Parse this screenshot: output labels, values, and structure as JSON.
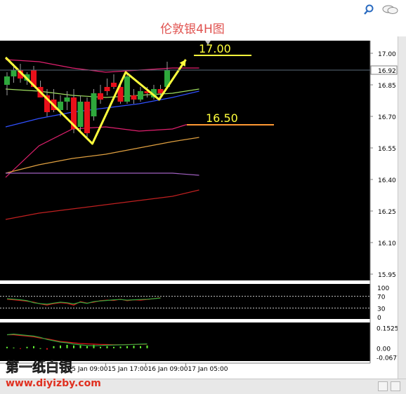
{
  "window": {
    "title": "伦敦银4H图",
    "icons": [
      "search-icon",
      "chat-icon"
    ]
  },
  "colors": {
    "background": "#000000",
    "bull": "#2ea83c",
    "bear": "#e8101a",
    "annotation": "#ffff3c",
    "level_line": "#ff9933"
  },
  "chart_data": {
    "type": "candlestick",
    "y_axis_ticks": [
      "17.00",
      "16.85",
      "16.70",
      "16.55",
      "16.40",
      "16.25",
      "16.10",
      "15.95"
    ],
    "ylim": [
      15.92,
      17.06
    ],
    "current_price": "16.92",
    "x_axis_ticks": [
      "15 Jan 09:00",
      "15 Jan 17:00",
      "16 Jan 09:00",
      "17 Jan 05:00"
    ],
    "candles": [
      {
        "o": 16.85,
        "h": 16.91,
        "l": 16.8,
        "c": 16.89
      },
      {
        "o": 16.89,
        "h": 16.95,
        "l": 16.86,
        "c": 16.92
      },
      {
        "o": 16.92,
        "h": 16.95,
        "l": 16.86,
        "c": 16.88
      },
      {
        "o": 16.87,
        "h": 16.91,
        "l": 16.85,
        "c": 16.9
      },
      {
        "o": 16.92,
        "h": 16.94,
        "l": 16.84,
        "c": 16.84
      },
      {
        "o": 16.84,
        "h": 16.87,
        "l": 16.79,
        "c": 16.79
      },
      {
        "o": 16.8,
        "h": 16.83,
        "l": 16.7,
        "c": 16.72
      },
      {
        "o": 16.78,
        "h": 16.83,
        "l": 16.72,
        "c": 16.73
      },
      {
        "o": 16.73,
        "h": 16.8,
        "l": 16.7,
        "c": 16.77
      },
      {
        "o": 16.77,
        "h": 16.82,
        "l": 16.73,
        "c": 16.79
      },
      {
        "o": 16.79,
        "h": 16.83,
        "l": 16.62,
        "c": 16.64
      },
      {
        "o": 16.65,
        "h": 16.8,
        "l": 16.63,
        "c": 16.77
      },
      {
        "o": 16.77,
        "h": 16.79,
        "l": 16.6,
        "c": 16.62
      },
      {
        "o": 16.7,
        "h": 16.83,
        "l": 16.68,
        "c": 16.81
      },
      {
        "o": 16.81,
        "h": 16.85,
        "l": 16.76,
        "c": 16.78
      },
      {
        "o": 16.84,
        "h": 16.88,
        "l": 16.8,
        "c": 16.82
      },
      {
        "o": 16.86,
        "h": 16.9,
        "l": 16.83,
        "c": 16.84
      },
      {
        "o": 16.84,
        "h": 16.87,
        "l": 16.76,
        "c": 16.77
      },
      {
        "o": 16.77,
        "h": 16.9,
        "l": 16.76,
        "c": 16.89
      },
      {
        "o": 16.8,
        "h": 16.83,
        "l": 16.76,
        "c": 16.78
      },
      {
        "o": 16.78,
        "h": 16.84,
        "l": 16.77,
        "c": 16.82
      },
      {
        "o": 16.82,
        "h": 16.84,
        "l": 16.79,
        "c": 16.81
      },
      {
        "o": 16.79,
        "h": 16.85,
        "l": 16.78,
        "c": 16.83
      },
      {
        "o": 16.83,
        "h": 16.85,
        "l": 16.8,
        "c": 16.81
      },
      {
        "o": 16.84,
        "h": 16.96,
        "l": 16.83,
        "c": 16.92
      }
    ],
    "annotations": {
      "upper_label": "17.00",
      "upper_level": 16.99,
      "lower_label": "16.50",
      "lower_level": 16.66,
      "zigzag": [
        [
          0,
          16.98
        ],
        [
          13,
          16.57
        ],
        [
          18,
          16.91
        ],
        [
          23,
          16.78
        ],
        [
          27,
          16.97
        ]
      ]
    },
    "overlays": [
      {
        "color": "#e0206e",
        "points": [
          [
            0,
            16.97
          ],
          [
            5,
            16.96
          ],
          [
            10,
            16.93
          ],
          [
            15,
            16.91
          ],
          [
            20,
            16.92
          ],
          [
            25,
            16.93
          ],
          [
            29,
            16.93
          ]
        ]
      },
      {
        "color": "#a0e060",
        "points": [
          [
            0,
            16.83
          ],
          [
            5,
            16.82
          ],
          [
            10,
            16.8
          ],
          [
            15,
            16.79
          ],
          [
            20,
            16.8
          ],
          [
            25,
            16.81
          ],
          [
            29,
            16.83
          ]
        ]
      },
      {
        "color": "#3050ff",
        "points": [
          [
            0,
            16.65
          ],
          [
            5,
            16.69
          ],
          [
            10,
            16.72
          ],
          [
            15,
            16.74
          ],
          [
            20,
            16.76
          ],
          [
            25,
            16.79
          ],
          [
            29,
            16.82
          ]
        ]
      },
      {
        "color": "#e0206e",
        "points": [
          [
            0,
            16.41
          ],
          [
            5,
            16.56
          ],
          [
            10,
            16.64
          ],
          [
            15,
            16.65
          ],
          [
            20,
            16.63
          ],
          [
            25,
            16.64
          ],
          [
            27,
            16.66
          ],
          [
            29,
            16.66
          ]
        ]
      },
      {
        "color": "#e0a040",
        "points": [
          [
            0,
            16.43
          ],
          [
            5,
            16.47
          ],
          [
            10,
            16.5
          ],
          [
            15,
            16.52
          ],
          [
            20,
            16.55
          ],
          [
            25,
            16.58
          ],
          [
            29,
            16.6
          ]
        ]
      },
      {
        "color": "#a060c0",
        "points": [
          [
            0,
            16.43
          ],
          [
            10,
            16.43
          ],
          [
            20,
            16.43
          ],
          [
            25,
            16.43
          ],
          [
            29,
            16.42
          ]
        ]
      },
      {
        "color": "#c02020",
        "points": [
          [
            0,
            16.21
          ],
          [
            5,
            16.24
          ],
          [
            10,
            16.26
          ],
          [
            15,
            16.28
          ],
          [
            20,
            16.3
          ],
          [
            25,
            16.32
          ],
          [
            29,
            16.35
          ]
        ]
      }
    ],
    "rsi_panel": {
      "ticks": [
        "100",
        "70",
        "30",
        "0"
      ],
      "levels": [
        70,
        30
      ],
      "series": [
        {
          "color": "#e8101a",
          "values": [
            60,
            58,
            56,
            53,
            50,
            44,
            40,
            45,
            48,
            46,
            40,
            52,
            47,
            50,
            55,
            57,
            56,
            60,
            55,
            58,
            57,
            59,
            62,
            65
          ]
        },
        {
          "color": "#2ea83c",
          "values": [
            62,
            60,
            58,
            55,
            48,
            45,
            43,
            47,
            50,
            48,
            44,
            50,
            46,
            52,
            54,
            56,
            58,
            59,
            57,
            58,
            59,
            60,
            62,
            64
          ]
        }
      ]
    },
    "macd_panel": {
      "ticks": [
        "0.1525",
        "0.00",
        "-0.0677"
      ],
      "ylim": [
        -0.08,
        0.16
      ],
      "hist": [
        0.01,
        0.005,
        -0.005,
        0.01,
        0.015,
        0.0,
        -0.01,
        0.015,
        0.02,
        0.025,
        0.02,
        0.02,
        0.015,
        0.025,
        0.01,
        0.015,
        0.01,
        0.012,
        0.015,
        0.018,
        0.015,
        0.02
      ],
      "signal": [
        0.1,
        0.1,
        0.095,
        0.09,
        0.085,
        0.075,
        0.07,
        0.06,
        0.05,
        0.045,
        0.04,
        0.035,
        0.032,
        0.03,
        0.028,
        0.027,
        0.026,
        0.026,
        0.027,
        0.028,
        0.029,
        0.03
      ],
      "macd": [
        0.1,
        0.105,
        0.1,
        0.095,
        0.09,
        0.08,
        0.065,
        0.055,
        0.045,
        0.04,
        0.03,
        0.025,
        0.02,
        0.018,
        0.02,
        0.022,
        0.024,
        0.025,
        0.026,
        0.028,
        0.03,
        0.032
      ]
    }
  },
  "watermark": {
    "line1": "第一纸白银",
    "line2": "www.diyizby.com"
  }
}
